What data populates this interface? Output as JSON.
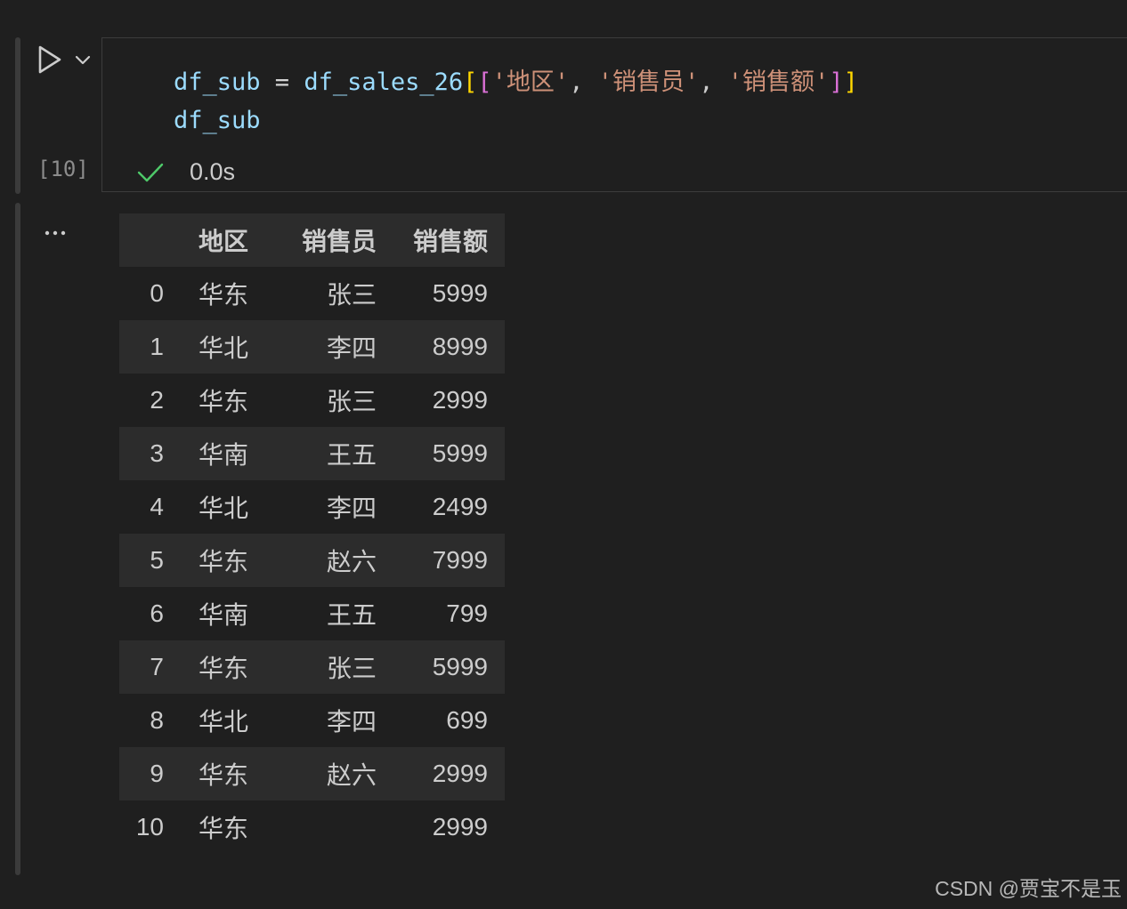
{
  "cell": {
    "execution_count": "[10]",
    "status": "success",
    "exec_time": "0.0s",
    "code_lines": [
      [
        {
          "t": "df_sub",
          "c": "var"
        },
        {
          "t": " = ",
          "c": "op"
        },
        {
          "t": "df_sales_26",
          "c": "var"
        },
        {
          "t": "[",
          "c": "b1"
        },
        {
          "t": "[",
          "c": "b2"
        },
        {
          "t": "'地区'",
          "c": "str"
        },
        {
          "t": ", ",
          "c": "punc"
        },
        {
          "t": "'销售员'",
          "c": "str"
        },
        {
          "t": ", ",
          "c": "punc"
        },
        {
          "t": "'销售额'",
          "c": "str"
        },
        {
          "t": "]",
          "c": "b2"
        },
        {
          "t": "]",
          "c": "b1"
        }
      ],
      [
        {
          "t": "df_sub",
          "c": "var"
        }
      ]
    ]
  },
  "output": {
    "more_label": "...",
    "table": {
      "columns": [
        "",
        "地区",
        "销售员",
        "销售额"
      ],
      "rows": [
        [
          "0",
          "华东",
          "张三",
          "5999"
        ],
        [
          "1",
          "华北",
          "李四",
          "8999"
        ],
        [
          "2",
          "华东",
          "张三",
          "2999"
        ],
        [
          "3",
          "华南",
          "王五",
          "5999"
        ],
        [
          "4",
          "华北",
          "李四",
          "2499"
        ],
        [
          "5",
          "华东",
          "赵六",
          "7999"
        ],
        [
          "6",
          "华南",
          "王五",
          "799"
        ],
        [
          "7",
          "华东",
          "张三",
          "5999"
        ],
        [
          "8",
          "华北",
          "李四",
          "699"
        ],
        [
          "9",
          "华东",
          "赵六",
          "2999"
        ],
        [
          "10",
          "华东",
          "",
          "2999"
        ]
      ]
    }
  },
  "watermark": "CSDN @贾宝不是玉",
  "colors": {
    "background": "#1f1f1f",
    "variable": "#9cdcfe",
    "string": "#ce9178",
    "bracket_outer": "#ffd700",
    "bracket_inner": "#da70d6",
    "success_check": "#4ec969",
    "stripe": "#2c2c2c"
  }
}
